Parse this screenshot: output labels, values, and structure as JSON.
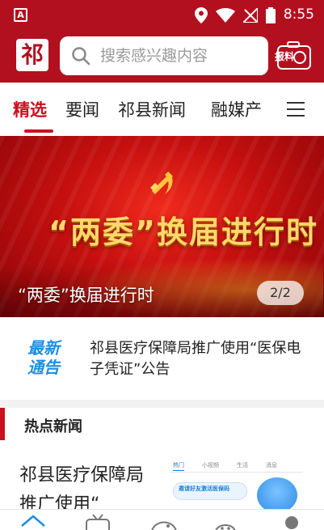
{
  "status_bar": {
    "notification_icon": "A",
    "icons": [
      "location-icon",
      "wifi-icon",
      "no-signal-icon",
      "battery-icon"
    ],
    "time": "8:55"
  },
  "header": {
    "logo_text": "祁",
    "search_placeholder": "搜索感兴趣内容",
    "report_label": "报料"
  },
  "tabs": {
    "items": [
      "精选",
      "要闻",
      "祁县新闻",
      "融媒产"
    ],
    "active_index": 0
  },
  "banner": {
    "headline": "“两委”换届进行时",
    "caption": "“两委”换届进行时",
    "page_indicator": "2/2"
  },
  "notice": {
    "badge_line1": "最新",
    "badge_line2": "通告",
    "text": "祁县医疗保障局推广使用“医保电子凭证”公告"
  },
  "hot_news": {
    "title": "热点新闻",
    "items": [
      {
        "title": "祁县医疗保障局推广使用“",
        "thumb_tabs": [
          "热门",
          "小视频",
          "生活",
          "消息"
        ],
        "thumb_text": "邀请好友激活医保码"
      }
    ]
  },
  "bottom_nav": {
    "items": [
      "home-icon",
      "tv-icon",
      "game-icon",
      "chat-icon",
      "profile-icon"
    ]
  },
  "colors": {
    "brand_red": "#b3101f",
    "accent_red": "#c8101f",
    "notice_blue": "#1e8fe0"
  }
}
